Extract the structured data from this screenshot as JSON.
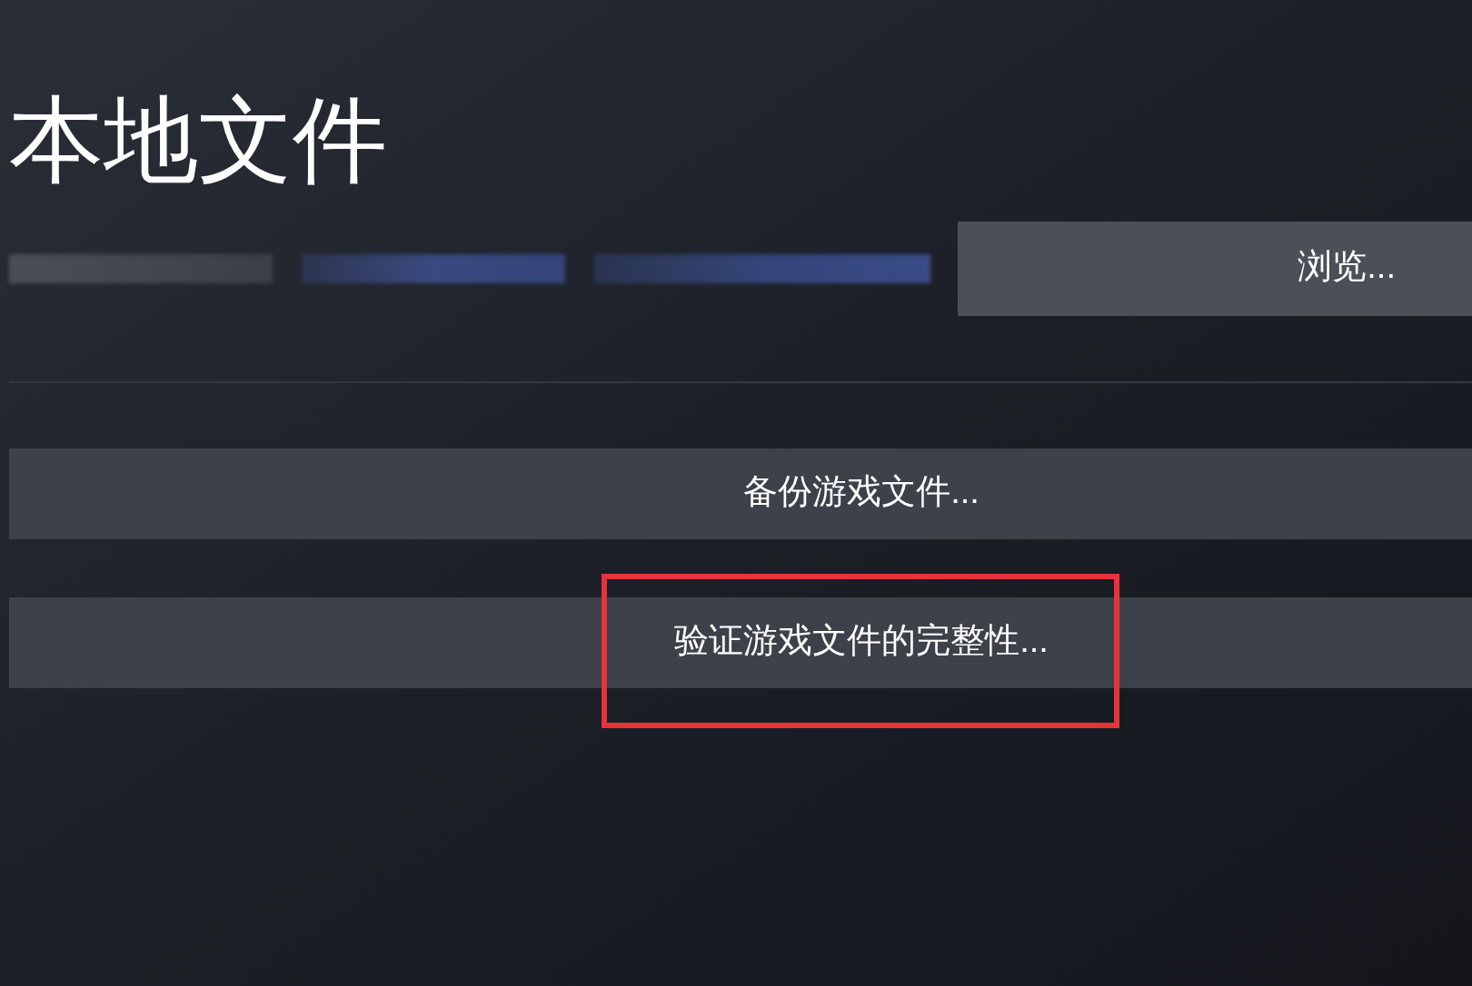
{
  "title": "本地文件",
  "install_info": [
    {
      "kind": "redacted"
    },
    {
      "kind": "redacted"
    },
    {
      "kind": "redacted"
    }
  ],
  "browse_button": {
    "label": "浏览..."
  },
  "actions": [
    {
      "label": "备份游戏文件...",
      "highlighted": false
    },
    {
      "label": "验证游戏文件的完整性...",
      "highlighted": true
    }
  ]
}
